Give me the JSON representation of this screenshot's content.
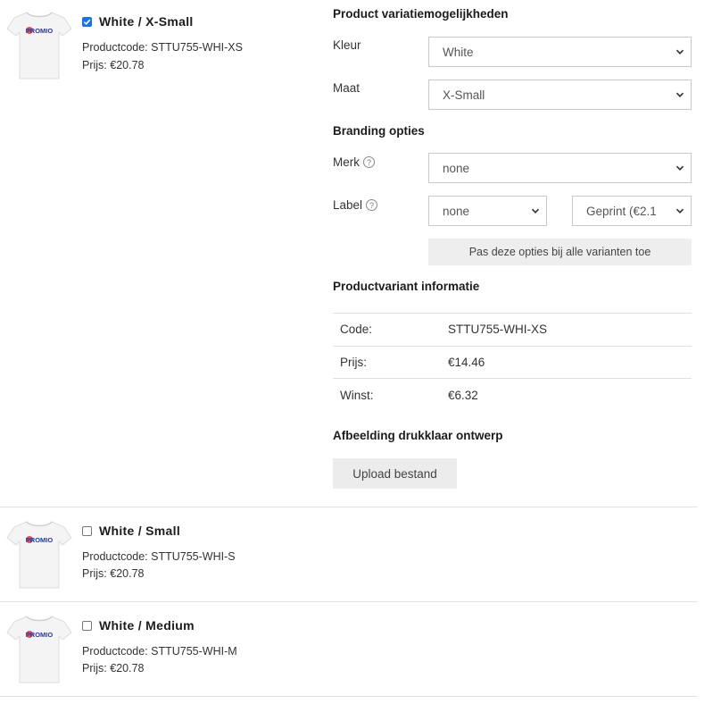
{
  "variants": [
    {
      "title": "White / X-Small",
      "checked": true,
      "code": "Productcode: STTU755-WHI-XS",
      "price": "Prijs: €20.78",
      "logo_text": "PROMIO"
    },
    {
      "title": "White / Small",
      "checked": false,
      "code": "Productcode: STTU755-WHI-S",
      "price": "Prijs: €20.78",
      "logo_text": "PROMIO"
    },
    {
      "title": "White / Medium",
      "checked": false,
      "code": "Productcode: STTU755-WHI-M",
      "price": "Prijs: €20.78",
      "logo_text": "PROMIO"
    }
  ],
  "options": {
    "section_title": "Product variatiemogelijkheden",
    "color_label": "Kleur",
    "color_value": "White",
    "size_label": "Maat",
    "size_value": "X-Small"
  },
  "branding": {
    "section_title": "Branding opties",
    "brand_label": "Merk",
    "brand_value": "none",
    "label_label": "Label",
    "label_value": "none",
    "label_print_value": "Geprint (€2.1",
    "apply_button": "Pas deze opties bij alle varianten toe",
    "help_glyph": "?"
  },
  "info": {
    "section_title": "Productvariant informatie",
    "rows": [
      {
        "key": "Code:",
        "value": "STTU755-WHI-XS"
      },
      {
        "key": "Prijs:",
        "value": "€14.46"
      },
      {
        "key": "Winst:",
        "value": "€6.32"
      }
    ]
  },
  "design": {
    "section_title": "Afbeelding drukklaar ontwerp",
    "upload_button": "Upload bestand"
  },
  "colors": {
    "checkbox_accent": "#1a73e8",
    "logo_blue": "#2b3a8f",
    "logo_red": "#d9363e"
  },
  "icons": {
    "thumbnail": "tshirt-icon",
    "dropdown": "chevron-down-icon",
    "help": "help-circle-icon",
    "check": "checkmark-icon"
  }
}
